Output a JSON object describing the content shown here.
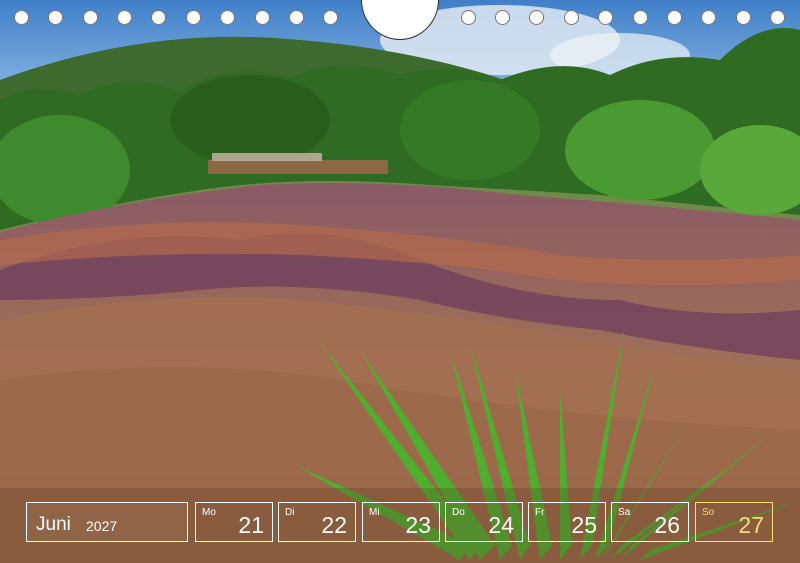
{
  "calendar": {
    "month": "Juni",
    "year": "2027",
    "days": [
      {
        "weekday": "Mo",
        "date": "21",
        "sunday": false
      },
      {
        "weekday": "Di",
        "date": "22",
        "sunday": false
      },
      {
        "weekday": "Mi",
        "date": "23",
        "sunday": false
      },
      {
        "weekday": "Do",
        "date": "24",
        "sunday": false
      },
      {
        "weekday": "Fr",
        "date": "25",
        "sunday": false
      },
      {
        "weekday": "Sa",
        "date": "26",
        "sunday": false
      },
      {
        "weekday": "So",
        "date": "27",
        "sunday": true
      }
    ]
  },
  "colors": {
    "frame": "#ffffff",
    "sunday": "#f2df7a"
  }
}
